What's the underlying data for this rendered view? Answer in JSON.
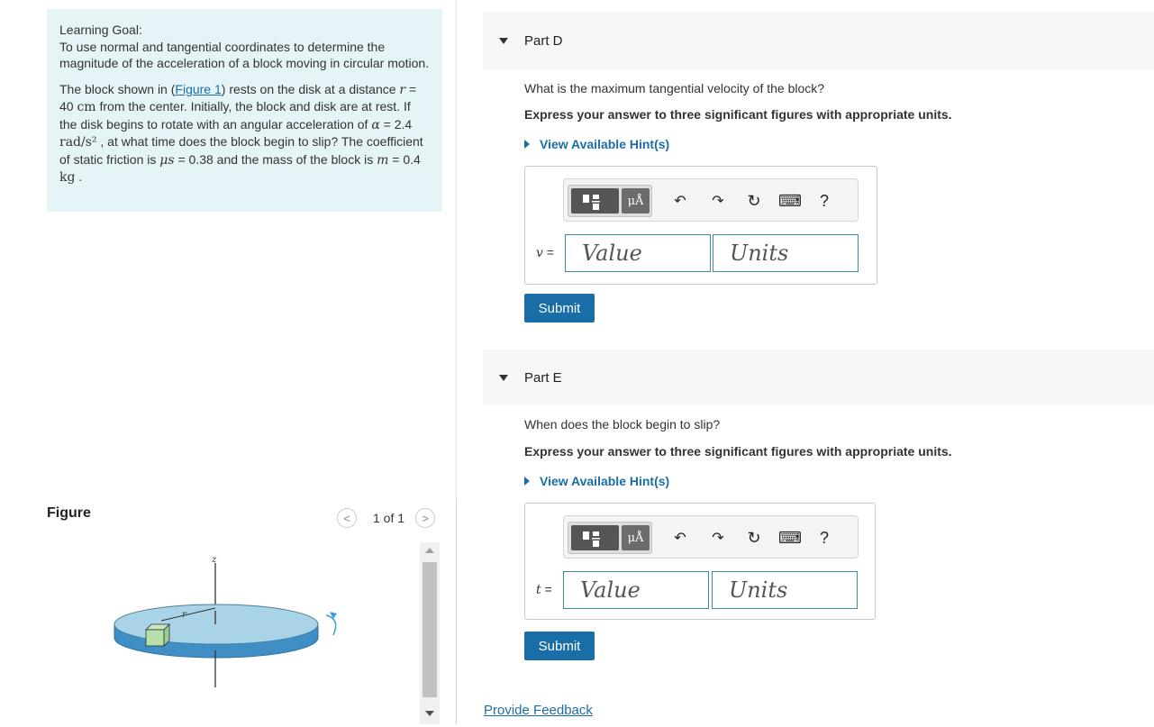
{
  "goal": {
    "title": "Learning Goal:",
    "text": "To use normal and tangential coordinates to determine the magnitude of the acceleration of a block moving in circular motion.",
    "intro_pre": "The block shown in (",
    "figure_link": "Figure 1",
    "intro_mid": ") rests on the disk at a distance ",
    "r_sym": "r",
    "r_val": " = 40 ",
    "r_unit": "cm",
    "intro_b": " from the center. Initially, the block and disk are at rest. If the disk begins to rotate with an angular acceleration of ",
    "alpha_sym": "α",
    "alpha_val": " = 2.4 ",
    "alpha_unit": "rad/s²",
    "intro_c": " , at what time does the block begin to slip? The coefficient of static friction is ",
    "mu_sym": "μs",
    "mu_val": " = 0.38 and the mass of the block is ",
    "m_sym": "m",
    "m_val": " = 0.4 ",
    "m_unit": "kg",
    "intro_end": " ."
  },
  "figure": {
    "label": "Figure",
    "counter": "1 of 1",
    "prev_icon": "<",
    "next_icon": ">",
    "z_label": "z",
    "r_label": "r"
  },
  "parts": [
    {
      "title": "Part D",
      "question": "What is the maximum tangential velocity of the block?",
      "instruction": "Express your answer to three significant figures with appropriate units.",
      "hint": "View Available Hint(s)",
      "var": "v",
      "eq": " =",
      "value_placeholder": "Value",
      "units_placeholder": "Units",
      "submit": "Submit"
    },
    {
      "title": "Part E",
      "question": "When does the block begin to slip?",
      "instruction": "Express your answer to three significant figures with appropriate units.",
      "hint": "View Available Hint(s)",
      "var": "t",
      "eq": " =",
      "value_placeholder": "Value",
      "units_placeholder": "Units",
      "submit": "Submit"
    }
  ],
  "toolbar": {
    "units_glyph": "μÅ",
    "undo": "↶",
    "redo": "↷",
    "reset": "↻",
    "keyboard": "⌨",
    "help": "?"
  },
  "feedback": "Provide Feedback"
}
